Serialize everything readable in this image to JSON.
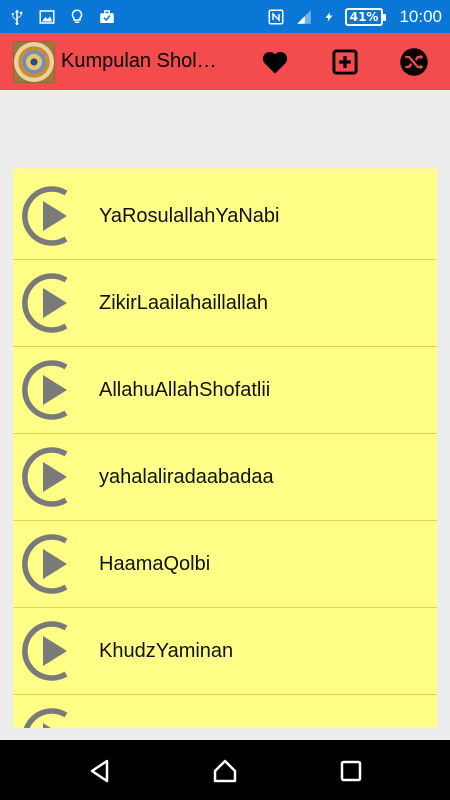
{
  "status_bar": {
    "battery": "41%",
    "time": "10:00",
    "icons": [
      "usb-icon",
      "image-icon",
      "lightbulb-icon",
      "briefcase-icon",
      "nfc-icon",
      "signal-icon",
      "charging-icon",
      "battery-icon"
    ]
  },
  "app_bar": {
    "title": "Kumpulan Shol…",
    "actions": [
      "heart-icon",
      "add-box-icon",
      "shuffle-icon"
    ],
    "color": "#f44c4c"
  },
  "list": {
    "background": "#ffff88",
    "items": [
      {
        "label": "YaRosulallahYaNabi"
      },
      {
        "label": "ZikirLaailahaillallah"
      },
      {
        "label": "AllahuAllahShofatlii"
      },
      {
        "label": "yahalaliradaabadaa"
      },
      {
        "label": "HaamaQolbi"
      },
      {
        "label": "KhudzYaminan"
      },
      {
        "label": ""
      }
    ]
  },
  "nav_bar": {
    "buttons": [
      "back-icon",
      "home-icon",
      "recents-icon"
    ]
  }
}
